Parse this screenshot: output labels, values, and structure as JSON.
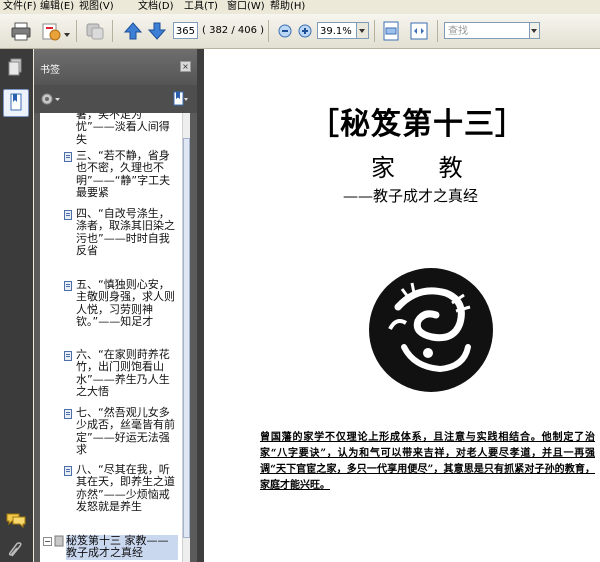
{
  "menu": {
    "items": [
      "文件(F)",
      "编辑(E)",
      "视图(V)",
      "文档(D)",
      "工具(T)",
      "窗口(W)",
      "帮助(H)"
    ]
  },
  "toolbar": {
    "page_current": "365",
    "page_count": "( 382 / 406 )",
    "zoom_value": "39.1%",
    "find_placeholder": "查找"
  },
  "nav": {
    "title": "书签",
    "close_label": "×",
    "bookmarks": [
      {
        "text": "暑，笑不足为忧”——淡看人间得失",
        "icon": false
      },
      {
        "text": "三、“若不静，省身也不密，久理也不明”——“静”字工夫最要紧",
        "icon": true
      },
      {
        "text": "四、“自改号涤生，涤者，取涤其旧染之污也”——时时自我反省",
        "icon": true
      },
      {
        "text": "五、“慎独则心安，主敬则身强，求人则人悦，习劳则神钦。”——知足才",
        "icon": true
      },
      {
        "text": "六、“在家则莳养花竹，出门则饱看山水”——养生乃人生之大悟",
        "icon": true
      },
      {
        "text": "七、“然吾观儿女多少成否，丝毫皆有前定”——好运无法强求",
        "icon": true
      },
      {
        "text": "八、“尽其在我，听其在天，即养生之道亦然”——少烦恼戒发怒就是养生",
        "icon": true
      },
      {
        "text": "秘笈第十三 家教——教子成才之真经",
        "icon": true,
        "selected": true
      }
    ]
  },
  "document": {
    "title_main": "［秘笈第十三］",
    "title_sub": "家 教",
    "title_tag": "——教子成才之真经",
    "paragraph": "曾国藩的家学不仅理论上形成体系，且注意与实践相结合。他制定了治家“八字要诀”，认为和气可以带来吉祥，对老人要尽孝道，并且一再强调“天下官宦之家，多只一代享用便尽”，其意思是只有抓紧对子孙的教育，家庭才能兴旺。"
  },
  "colors": {
    "nav_bg": "#5b5b5b",
    "nav_dark": "#3b3b3b",
    "selection": "#c9d7ef",
    "toolbar_bg": "#ece9d8"
  }
}
